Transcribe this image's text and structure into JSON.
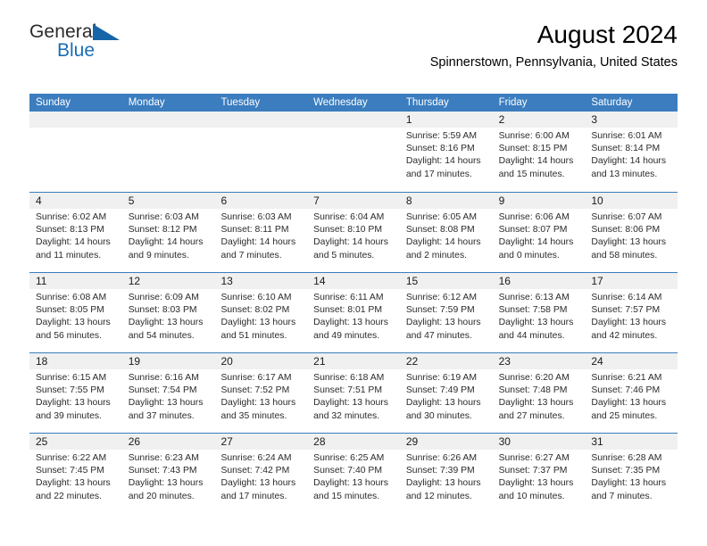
{
  "brand": {
    "word_one": "General",
    "word_two": "Blue",
    "accent_color": "#1a6db5"
  },
  "header": {
    "month_title": "August 2024",
    "location": "Spinnerstown, Pennsylvania, United States"
  },
  "calendar": {
    "header_color": "#3b7dbf",
    "daynum_band_color": "#f0f0f0",
    "weekdays": [
      "Sunday",
      "Monday",
      "Tuesday",
      "Wednesday",
      "Thursday",
      "Friday",
      "Saturday"
    ],
    "weeks": [
      [
        {
          "day": "",
          "lines": []
        },
        {
          "day": "",
          "lines": []
        },
        {
          "day": "",
          "lines": []
        },
        {
          "day": "",
          "lines": []
        },
        {
          "day": "1",
          "lines": [
            "Sunrise: 5:59 AM",
            "Sunset: 8:16 PM",
            "Daylight: 14 hours",
            "and 17 minutes."
          ]
        },
        {
          "day": "2",
          "lines": [
            "Sunrise: 6:00 AM",
            "Sunset: 8:15 PM",
            "Daylight: 14 hours",
            "and 15 minutes."
          ]
        },
        {
          "day": "3",
          "lines": [
            "Sunrise: 6:01 AM",
            "Sunset: 8:14 PM",
            "Daylight: 14 hours",
            "and 13 minutes."
          ]
        }
      ],
      [
        {
          "day": "4",
          "lines": [
            "Sunrise: 6:02 AM",
            "Sunset: 8:13 PM",
            "Daylight: 14 hours",
            "and 11 minutes."
          ]
        },
        {
          "day": "5",
          "lines": [
            "Sunrise: 6:03 AM",
            "Sunset: 8:12 PM",
            "Daylight: 14 hours",
            "and 9 minutes."
          ]
        },
        {
          "day": "6",
          "lines": [
            "Sunrise: 6:03 AM",
            "Sunset: 8:11 PM",
            "Daylight: 14 hours",
            "and 7 minutes."
          ]
        },
        {
          "day": "7",
          "lines": [
            "Sunrise: 6:04 AM",
            "Sunset: 8:10 PM",
            "Daylight: 14 hours",
            "and 5 minutes."
          ]
        },
        {
          "day": "8",
          "lines": [
            "Sunrise: 6:05 AM",
            "Sunset: 8:08 PM",
            "Daylight: 14 hours",
            "and 2 minutes."
          ]
        },
        {
          "day": "9",
          "lines": [
            "Sunrise: 6:06 AM",
            "Sunset: 8:07 PM",
            "Daylight: 14 hours",
            "and 0 minutes."
          ]
        },
        {
          "day": "10",
          "lines": [
            "Sunrise: 6:07 AM",
            "Sunset: 8:06 PM",
            "Daylight: 13 hours",
            "and 58 minutes."
          ]
        }
      ],
      [
        {
          "day": "11",
          "lines": [
            "Sunrise: 6:08 AM",
            "Sunset: 8:05 PM",
            "Daylight: 13 hours",
            "and 56 minutes."
          ]
        },
        {
          "day": "12",
          "lines": [
            "Sunrise: 6:09 AM",
            "Sunset: 8:03 PM",
            "Daylight: 13 hours",
            "and 54 minutes."
          ]
        },
        {
          "day": "13",
          "lines": [
            "Sunrise: 6:10 AM",
            "Sunset: 8:02 PM",
            "Daylight: 13 hours",
            "and 51 minutes."
          ]
        },
        {
          "day": "14",
          "lines": [
            "Sunrise: 6:11 AM",
            "Sunset: 8:01 PM",
            "Daylight: 13 hours",
            "and 49 minutes."
          ]
        },
        {
          "day": "15",
          "lines": [
            "Sunrise: 6:12 AM",
            "Sunset: 7:59 PM",
            "Daylight: 13 hours",
            "and 47 minutes."
          ]
        },
        {
          "day": "16",
          "lines": [
            "Sunrise: 6:13 AM",
            "Sunset: 7:58 PM",
            "Daylight: 13 hours",
            "and 44 minutes."
          ]
        },
        {
          "day": "17",
          "lines": [
            "Sunrise: 6:14 AM",
            "Sunset: 7:57 PM",
            "Daylight: 13 hours",
            "and 42 minutes."
          ]
        }
      ],
      [
        {
          "day": "18",
          "lines": [
            "Sunrise: 6:15 AM",
            "Sunset: 7:55 PM",
            "Daylight: 13 hours",
            "and 39 minutes."
          ]
        },
        {
          "day": "19",
          "lines": [
            "Sunrise: 6:16 AM",
            "Sunset: 7:54 PM",
            "Daylight: 13 hours",
            "and 37 minutes."
          ]
        },
        {
          "day": "20",
          "lines": [
            "Sunrise: 6:17 AM",
            "Sunset: 7:52 PM",
            "Daylight: 13 hours",
            "and 35 minutes."
          ]
        },
        {
          "day": "21",
          "lines": [
            "Sunrise: 6:18 AM",
            "Sunset: 7:51 PM",
            "Daylight: 13 hours",
            "and 32 minutes."
          ]
        },
        {
          "day": "22",
          "lines": [
            "Sunrise: 6:19 AM",
            "Sunset: 7:49 PM",
            "Daylight: 13 hours",
            "and 30 minutes."
          ]
        },
        {
          "day": "23",
          "lines": [
            "Sunrise: 6:20 AM",
            "Sunset: 7:48 PM",
            "Daylight: 13 hours",
            "and 27 minutes."
          ]
        },
        {
          "day": "24",
          "lines": [
            "Sunrise: 6:21 AM",
            "Sunset: 7:46 PM",
            "Daylight: 13 hours",
            "and 25 minutes."
          ]
        }
      ],
      [
        {
          "day": "25",
          "lines": [
            "Sunrise: 6:22 AM",
            "Sunset: 7:45 PM",
            "Daylight: 13 hours",
            "and 22 minutes."
          ]
        },
        {
          "day": "26",
          "lines": [
            "Sunrise: 6:23 AM",
            "Sunset: 7:43 PM",
            "Daylight: 13 hours",
            "and 20 minutes."
          ]
        },
        {
          "day": "27",
          "lines": [
            "Sunrise: 6:24 AM",
            "Sunset: 7:42 PM",
            "Daylight: 13 hours",
            "and 17 minutes."
          ]
        },
        {
          "day": "28",
          "lines": [
            "Sunrise: 6:25 AM",
            "Sunset: 7:40 PM",
            "Daylight: 13 hours",
            "and 15 minutes."
          ]
        },
        {
          "day": "29",
          "lines": [
            "Sunrise: 6:26 AM",
            "Sunset: 7:39 PM",
            "Daylight: 13 hours",
            "and 12 minutes."
          ]
        },
        {
          "day": "30",
          "lines": [
            "Sunrise: 6:27 AM",
            "Sunset: 7:37 PM",
            "Daylight: 13 hours",
            "and 10 minutes."
          ]
        },
        {
          "day": "31",
          "lines": [
            "Sunrise: 6:28 AM",
            "Sunset: 7:35 PM",
            "Daylight: 13 hours",
            "and 7 minutes."
          ]
        }
      ]
    ]
  }
}
